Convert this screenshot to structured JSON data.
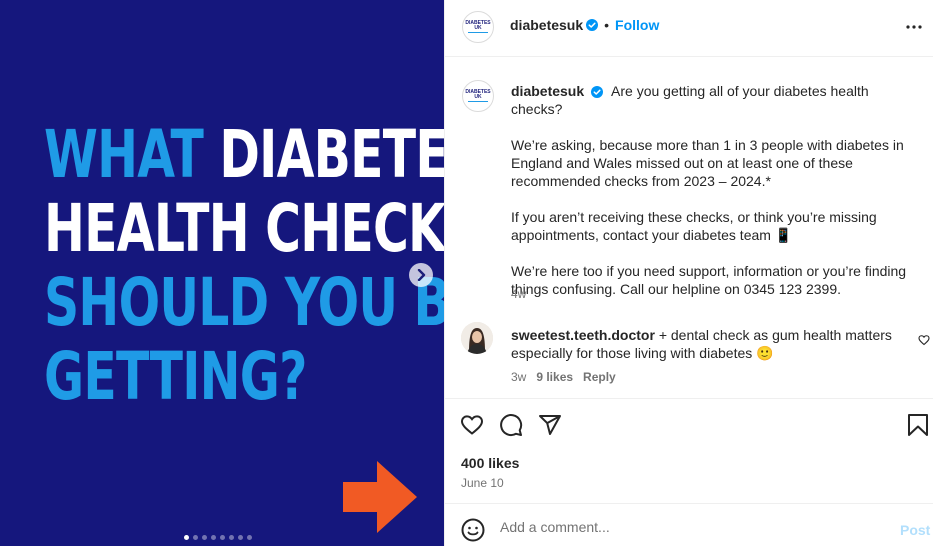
{
  "media": {
    "headline": [
      {
        "parts": [
          {
            "text": "WHAT ",
            "color": "blue"
          },
          {
            "text": "DIABETES",
            "color": "white"
          }
        ]
      },
      {
        "parts": [
          {
            "text": "HEALTH CHECKS",
            "color": "white"
          }
        ]
      },
      {
        "parts": [
          {
            "text": "SHOULD YOU BE",
            "color": "blue"
          }
        ]
      },
      {
        "parts": [
          {
            "text": "GETTING?",
            "color": "blue"
          }
        ]
      }
    ],
    "background_color": "#15177d",
    "accent_blue": "#1f9be6",
    "arrow_color": "#f15a24",
    "slide_count": 8,
    "active_slide": 1
  },
  "header": {
    "username": "diabetesuk",
    "bullet": "•",
    "follow_label": "Follow",
    "logo_text": "DIABETES UK"
  },
  "caption": {
    "username": "diabetesuk",
    "paragraphs": [
      "Are you getting all of your diabetes health checks?",
      "We’re asking, because more than 1 in 3 people with diabetes in England and Wales missed out on at least one of these recommended checks from 2023 – 2024.*",
      "If you aren’t receiving these checks, or think you’re missing appointments, contact your diabetes team 📱",
      "We’re here too if you need support, information or you’re finding things confusing. Call our helpline on 0345 123 2399."
    ],
    "time": "4w"
  },
  "comment": {
    "username": "sweetest.teeth.doctor",
    "text": "+ dental check as gum health matters especially for those living with diabetes 🙂",
    "time": "3w",
    "likes": "9 likes",
    "reply_label": "Reply"
  },
  "post": {
    "likes": "400 likes",
    "date": "June 10"
  },
  "composer": {
    "placeholder": "Add a comment...",
    "post_label": "Post"
  },
  "icons": {
    "verified": "verified-badge-icon",
    "more": "more-options-icon",
    "like": "heart-icon",
    "comment": "comment-icon",
    "share": "share-icon",
    "save": "bookmark-icon",
    "emoji": "emoji-icon",
    "next": "chevron-right-icon"
  },
  "colors": {
    "link_blue": "#0095f6",
    "post_disabled": "#b2dffc",
    "verified_blue": "#0095f6",
    "muted_text": "#737373"
  }
}
